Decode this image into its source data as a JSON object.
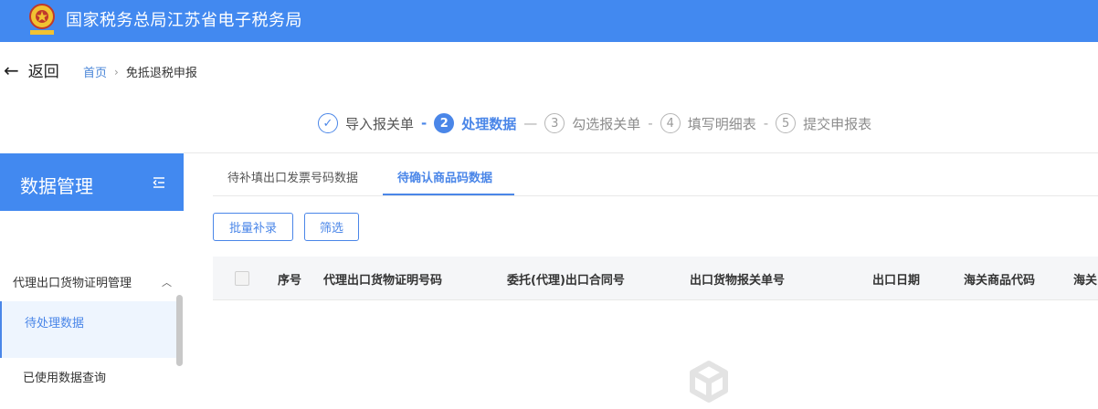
{
  "header": {
    "title": "国家税务总局江苏省电子税务局",
    "logo_icon": "tax-emblem-icon",
    "bg_color": "#4289f0"
  },
  "nav": {
    "back_label": "返回",
    "breadcrumb": {
      "home": "首页",
      "separator": "›",
      "current": "免抵退税申报"
    }
  },
  "steps": [
    {
      "num": "",
      "label": "导入报关单",
      "state": "done"
    },
    {
      "num": "2",
      "label": "处理数据",
      "state": "active"
    },
    {
      "num": "3",
      "label": "勾选报关单",
      "state": "pending"
    },
    {
      "num": "4",
      "label": "填写明细表",
      "state": "pending"
    },
    {
      "num": "5",
      "label": "提交申报表",
      "state": "pending"
    }
  ],
  "step_separators": [
    "-",
    "—",
    "-",
    "-"
  ],
  "sidebar": {
    "title": "数据管理",
    "group_label": "代理出口货物证明管理",
    "items": [
      {
        "label": "待处理数据",
        "active": true
      },
      {
        "label": "已使用数据查询",
        "active": false
      }
    ]
  },
  "tabs": [
    {
      "label": "待补填出口发票号码数据",
      "active": false
    },
    {
      "label": "待确认商品码数据",
      "active": true
    }
  ],
  "toolbar": {
    "batch_label": "批量补录",
    "filter_label": "筛选"
  },
  "table": {
    "columns": [
      "序号",
      "代理出口货物证明号码",
      "委托(代理)出口合同号",
      "出口货物报关单号",
      "出口日期",
      "海关商品代码",
      "海关"
    ]
  },
  "colors": {
    "accent": "#4a86e8",
    "header_bg": "#4289f0"
  }
}
